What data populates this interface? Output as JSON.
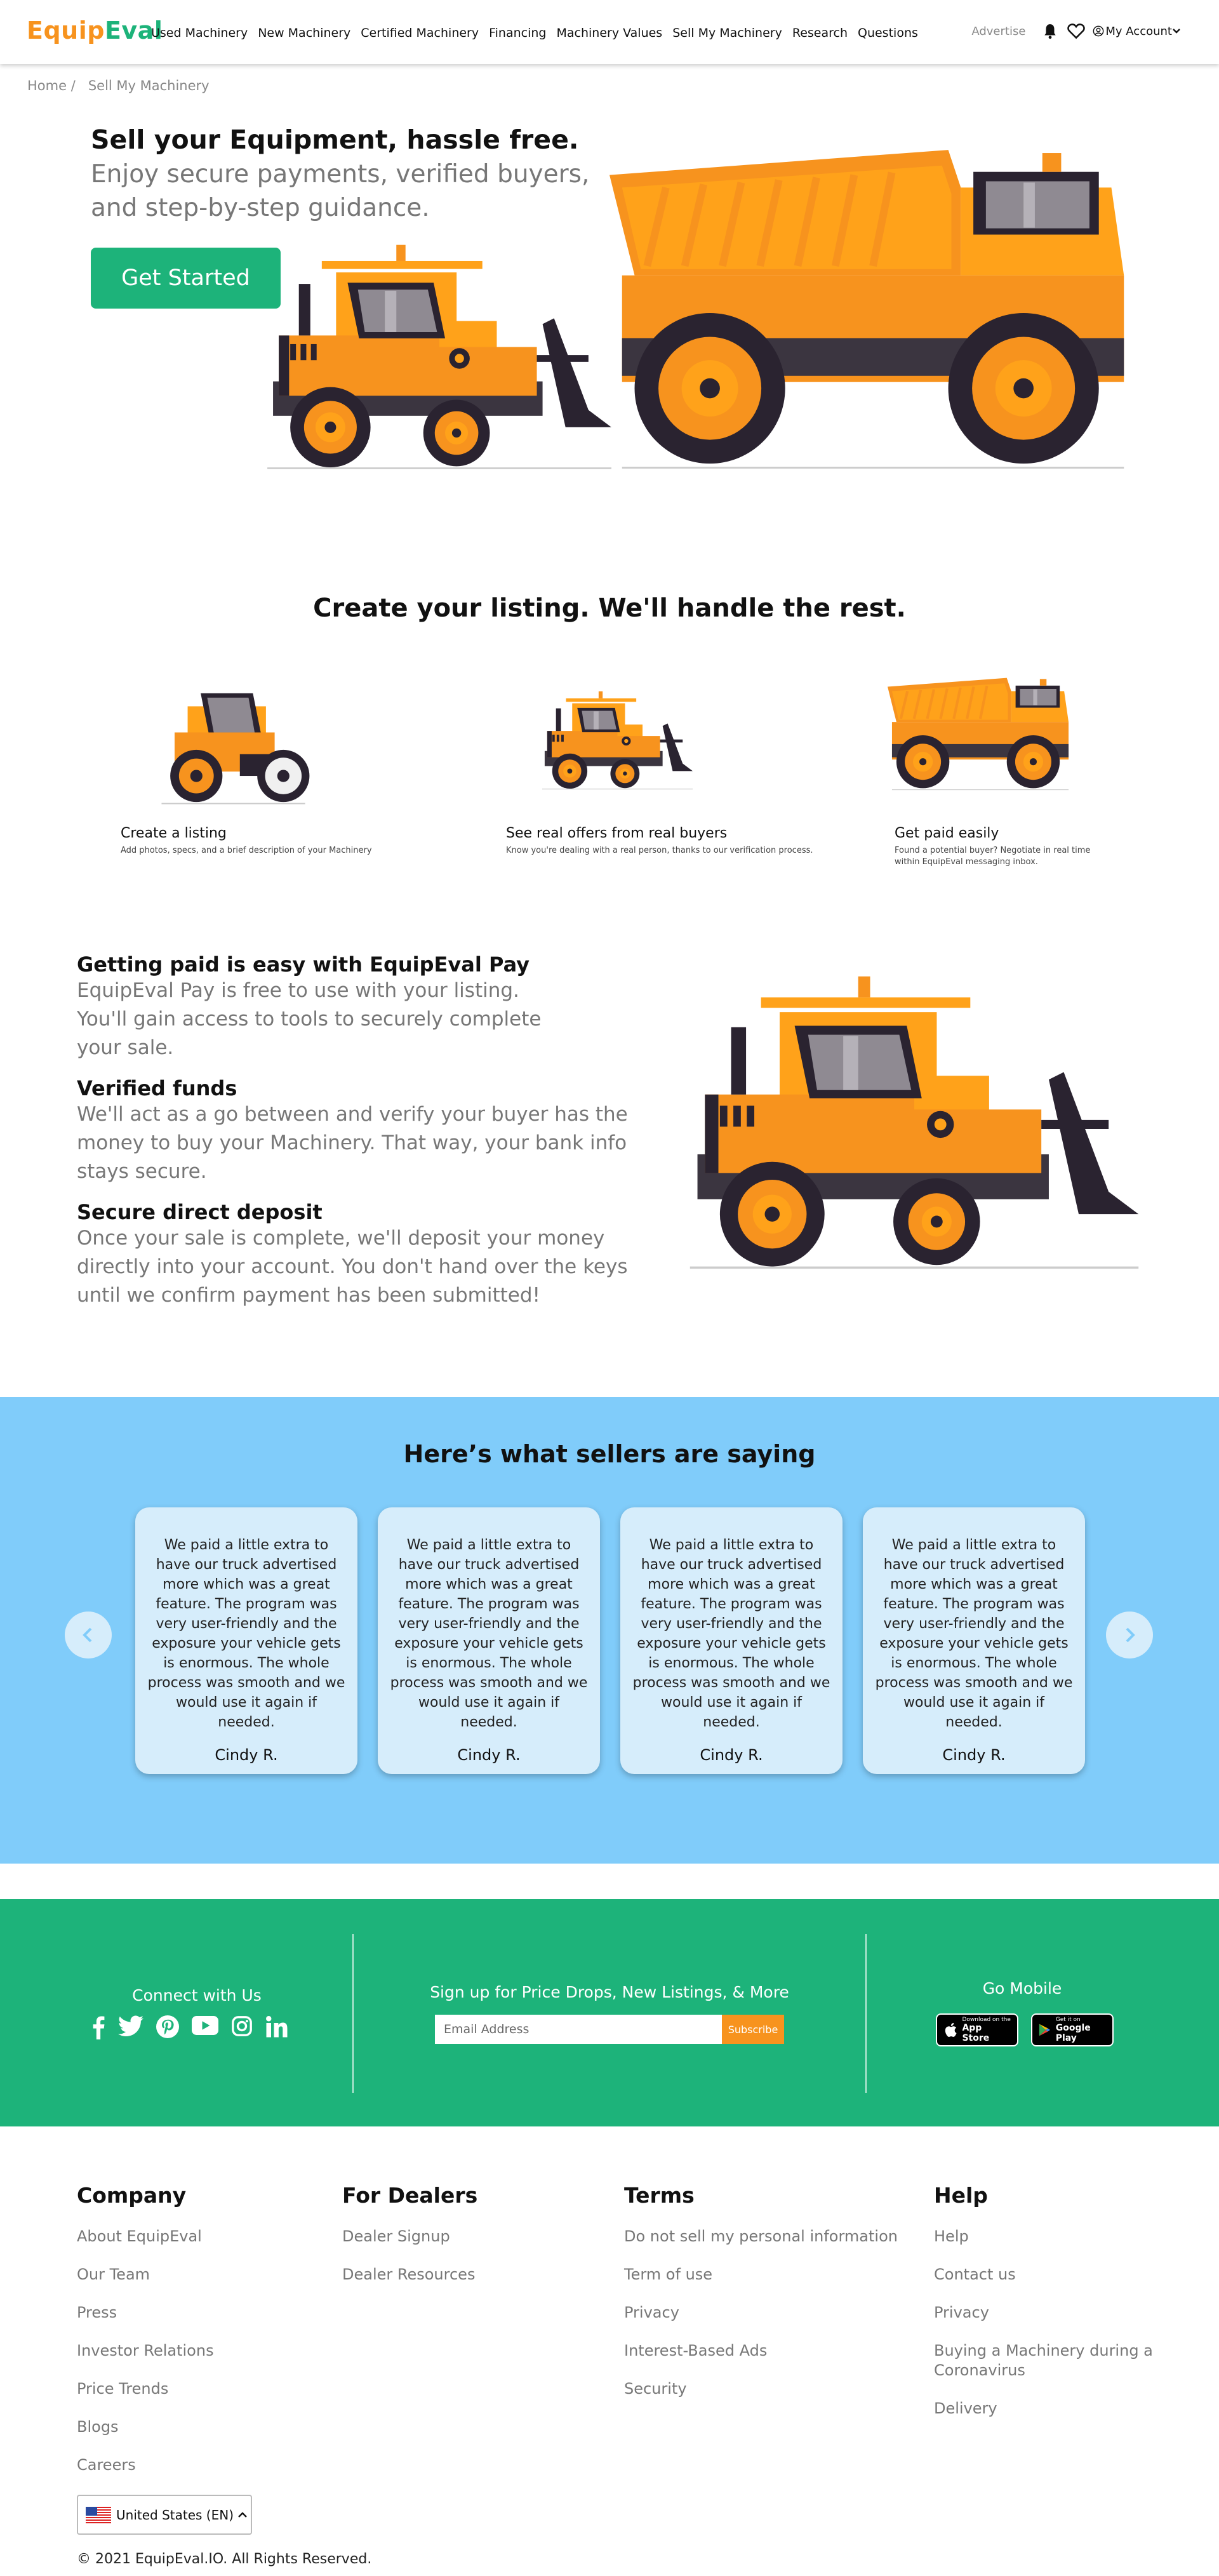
{
  "header": {
    "logo_part1": "Equip",
    "logo_part2": "Eval",
    "nav": [
      "Used Machinery",
      "New Machinery",
      "Certified Machinery",
      "Financing",
      "Machinery Values",
      "Sell My Machinery",
      "Research",
      "Questions"
    ],
    "advertise": "Advertise",
    "account": "My Account"
  },
  "breadcrumb": {
    "home": "Home",
    "separator": "/",
    "current": "Sell My Machinery"
  },
  "hero": {
    "title": "Sell your Equipment, hassle free.",
    "subtitle": "Enjoy secure payments, verified buyers, and step-by-step guidance.",
    "cta": "Get Started"
  },
  "steps": {
    "title": "Create your listing. We'll handle the rest.",
    "items": [
      {
        "title": "Create a listing",
        "desc": "Add photos, specs, and a brief description of your Machinery"
      },
      {
        "title": "See real offers from real buyers",
        "desc": "Know you're dealing with a real person, thanks to our verification process."
      },
      {
        "title": "Get paid easily",
        "desc": "Found a potential buyer? Negotiate in real time within EquipEval messaging inbox."
      }
    ]
  },
  "pay": [
    {
      "title": "Getting paid is easy with EquipEval Pay",
      "text": "EquipEval Pay is free to use with your listing. You'll gain access to tools to securely complete your sale."
    },
    {
      "title": "Verified funds",
      "text": "We'll act as a go between and verify your buyer has the money to buy your Machinery. That way, your bank info stays secure."
    },
    {
      "title": "Secure direct deposit",
      "text": "Once your sale is complete, we'll deposit your money directly into your account. You don't hand over the keys until we confirm payment has been submitted!"
    }
  ],
  "testimonials": {
    "title": "Here’s what sellers are saying",
    "items": [
      {
        "quote": "We paid a little extra to have our truck advertised more which was a great feature. The program was very user-friendly and the exposure your vehicle gets is enormous. The whole process was smooth and we would use it again if needed.",
        "name": "Cindy R."
      },
      {
        "quote": "We paid a little extra to have our truck advertised more which was a great feature. The program was very user-friendly and the exposure your vehicle gets is enormous. The whole process was smooth and we would use it again if needed.",
        "name": "Cindy R."
      },
      {
        "quote": "We paid a little extra to have our truck advertised more which was a great feature. The program was very user-friendly and the exposure your vehicle gets is enormous. The whole process was smooth and we would use it again if needed.",
        "name": "Cindy R."
      },
      {
        "quote": "We paid a little extra to have our truck advertised more which was a great feature. The program was very user-friendly and the exposure your vehicle gets is enormous. The whole process was smooth and we would use it again if needed.",
        "name": "Cindy R."
      }
    ]
  },
  "green_footer": {
    "connect": "Connect with Us",
    "signup": "Sign up for Price Drops, New Listings, & More",
    "email_placeholder": "Email Address",
    "subscribe": "Subscribe",
    "mobile": "Go Mobile",
    "app_store_top": "Download on the",
    "app_store": "App Store",
    "google_play_top": "Get it on",
    "google_play": "Google Play"
  },
  "footer": {
    "columns": [
      {
        "title": "Company",
        "links": [
          "About EquipEval",
          "Our Team",
          "Press",
          "Investor Relations",
          "Price Trends",
          "Blogs",
          "Careers"
        ]
      },
      {
        "title": "For Dealers",
        "links": [
          "Dealer Signup",
          "Dealer Resources"
        ]
      },
      {
        "title": "Terms",
        "links": [
          "Do not sell my personal information",
          "Term of use",
          "Privacy",
          "Interest-Based Ads",
          "Security"
        ]
      },
      {
        "title": "Help",
        "links": [
          "Help",
          "Contact us",
          "Privacy",
          "Buying a Machinery during a Coronavirus",
          "Delivery"
        ]
      }
    ],
    "locale": "United States (EN)",
    "copyright": "© 2021 EquipEval.IO. All Rights Reserved."
  },
  "colors": {
    "brand_green": "#1db37a",
    "brand_orange": "#f7931e",
    "testimonial_bg": "#80ccfa"
  }
}
